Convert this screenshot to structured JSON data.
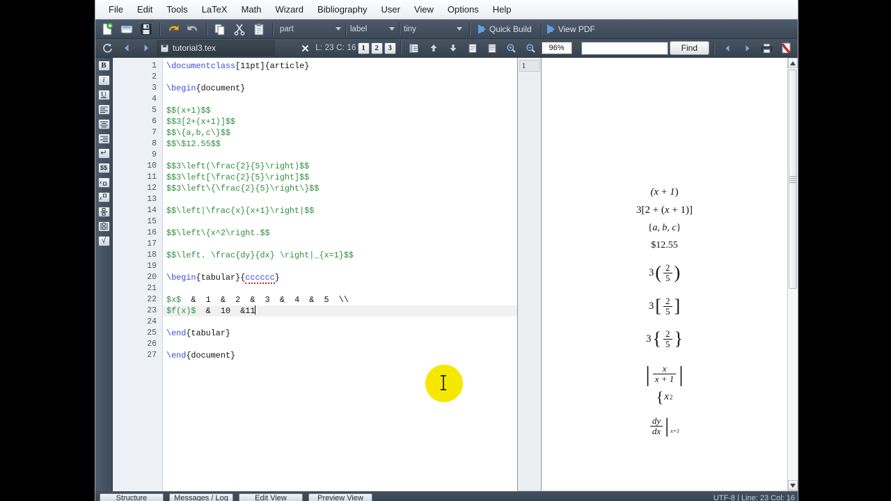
{
  "app": {
    "title": "TeXstudio"
  },
  "menubar": {
    "items": [
      {
        "label": "File",
        "name": "menu-file"
      },
      {
        "label": "Edit",
        "name": "menu-edit"
      },
      {
        "label": "Tools",
        "name": "menu-tools"
      },
      {
        "label": "LaTeX",
        "name": "menu-latex"
      },
      {
        "label": "Math",
        "name": "menu-math"
      },
      {
        "label": "Wizard",
        "name": "menu-wizard"
      },
      {
        "label": "Bibliography",
        "name": "menu-bibliography"
      },
      {
        "label": "User",
        "name": "menu-user"
      },
      {
        "label": "View",
        "name": "menu-view"
      },
      {
        "label": "Options",
        "name": "menu-options"
      },
      {
        "label": "Help",
        "name": "menu-help"
      }
    ]
  },
  "toolbar_main": {
    "icons": [
      {
        "name": "new-document-icon",
        "glyph": "new"
      },
      {
        "name": "open-document-icon",
        "glyph": "open"
      },
      {
        "name": "save-document-icon",
        "glyph": "save"
      },
      {
        "name": "undo-icon",
        "glyph": "undo"
      },
      {
        "name": "redo-icon",
        "glyph": "redo"
      },
      {
        "name": "copy-icon",
        "glyph": "copy"
      },
      {
        "name": "cut-icon",
        "glyph": "cut"
      },
      {
        "name": "paste-icon",
        "glyph": "paste"
      }
    ],
    "combo_structure": "part",
    "combo_label": "label",
    "combo_size": "tiny",
    "quick_build_label": "Quick Build",
    "view_pdf_label": "View PDF"
  },
  "toolbar_doc": {
    "filename": "tutorial3.tex",
    "cursor_position": "L: 23 C: 16",
    "bookmarks": [
      "1",
      "2",
      "3"
    ],
    "zoom": "96%",
    "find_placeholder": "",
    "find_value": "",
    "find_button": "Find"
  },
  "side_tools": {
    "items": [
      {
        "name": "bold-icon",
        "glyph": "B"
      },
      {
        "name": "italic-icon",
        "glyph": "i"
      },
      {
        "name": "underline-icon",
        "glyph": "U"
      },
      {
        "name": "align-left-icon",
        "glyph": "≡"
      },
      {
        "name": "align-center-icon",
        "glyph": "≡"
      },
      {
        "name": "align-right-icon",
        "glyph": "≡"
      },
      {
        "name": "newline-icon",
        "glyph": "↵"
      },
      {
        "name": "math-mode-icon",
        "glyph": "$$"
      },
      {
        "name": "subscript-icon",
        "glyph": "x▫"
      },
      {
        "name": "superscript-icon",
        "glyph": "x▫"
      },
      {
        "name": "fraction-icon",
        "glyph": "▫"
      },
      {
        "name": "binomial-icon",
        "glyph": "▫"
      },
      {
        "name": "sqrt-icon",
        "glyph": "√"
      }
    ]
  },
  "editor": {
    "current_line": 23,
    "lines": [
      {
        "n": 1,
        "tokens": [
          {
            "t": "cmd",
            "s": "\\documentclass"
          },
          {
            "t": "plain",
            "s": "[11pt]{article}"
          }
        ]
      },
      {
        "n": 2,
        "tokens": []
      },
      {
        "n": 3,
        "tokens": [
          {
            "t": "cmd",
            "s": "\\begin"
          },
          {
            "t": "plain",
            "s": "{document}"
          }
        ]
      },
      {
        "n": 4,
        "tokens": []
      },
      {
        "n": 5,
        "tokens": [
          {
            "t": "math",
            "s": "$$(x+1)$$"
          }
        ]
      },
      {
        "n": 6,
        "tokens": [
          {
            "t": "math",
            "s": "$$3[2+(x+1)]$$"
          }
        ]
      },
      {
        "n": 7,
        "tokens": [
          {
            "t": "math",
            "s": "$$\\{a,b,c\\}$$"
          }
        ]
      },
      {
        "n": 8,
        "tokens": [
          {
            "t": "math",
            "s": "$$\\$12.55$$"
          }
        ]
      },
      {
        "n": 9,
        "tokens": []
      },
      {
        "n": 10,
        "tokens": [
          {
            "t": "math",
            "s": "$$3\\left(\\frac{2}{5}\\right)$$"
          }
        ]
      },
      {
        "n": 11,
        "tokens": [
          {
            "t": "math",
            "s": "$$3\\left[\\frac{2}{5}\\right]$$"
          }
        ]
      },
      {
        "n": 12,
        "tokens": [
          {
            "t": "math",
            "s": "$$3\\left\\{\\frac{2}{5}\\right\\}$$"
          }
        ]
      },
      {
        "n": 13,
        "tokens": []
      },
      {
        "n": 14,
        "tokens": [
          {
            "t": "math",
            "s": "$$\\left|\\frac{x}{x+1}\\right|$$"
          }
        ]
      },
      {
        "n": 15,
        "tokens": []
      },
      {
        "n": 16,
        "tokens": [
          {
            "t": "math",
            "s": "$$\\left\\{x^2\\right.$$"
          }
        ]
      },
      {
        "n": 17,
        "tokens": []
      },
      {
        "n": 18,
        "tokens": [
          {
            "t": "math",
            "s": "$$\\left. \\frac{dy}{dx} \\right|_{x=1}$$"
          }
        ]
      },
      {
        "n": 19,
        "tokens": []
      },
      {
        "n": 20,
        "tokens": [
          {
            "t": "cmd",
            "s": "\\begin"
          },
          {
            "t": "plain",
            "s": "{tabular}{"
          },
          {
            "t": "misspell",
            "s": "cccccc"
          },
          {
            "t": "plain",
            "s": "}"
          }
        ]
      },
      {
        "n": 21,
        "tokens": []
      },
      {
        "n": 22,
        "tokens": [
          {
            "t": "math",
            "s": "$x$"
          },
          {
            "t": "plain",
            "s": "  &  1  &  2  &  3  &  4  &  5  \\\\"
          }
        ]
      },
      {
        "n": 23,
        "tokens": [
          {
            "t": "math",
            "s": "$f(x)$"
          },
          {
            "t": "plain",
            "s": "  &  10  &11"
          },
          {
            "t": "caret",
            "s": ""
          }
        ]
      },
      {
        "n": 24,
        "tokens": []
      },
      {
        "n": 25,
        "tokens": [
          {
            "t": "cmd",
            "s": "\\end"
          },
          {
            "t": "plain",
            "s": "{tabular}"
          }
        ]
      },
      {
        "n": 26,
        "tokens": []
      },
      {
        "n": 27,
        "tokens": [
          {
            "t": "cmd",
            "s": "\\end"
          },
          {
            "t": "plain",
            "s": "{document}"
          }
        ]
      }
    ]
  },
  "pdf": {
    "thumbnails": [
      "1"
    ],
    "rendered": [
      {
        "id": "expr-paren",
        "text": "(x + 1)"
      },
      {
        "id": "expr-bracket",
        "text": "3[2 + (x + 1)]"
      },
      {
        "id": "expr-brace",
        "text": "{a, b, c}"
      },
      {
        "id": "expr-dollar",
        "text": "$12.55"
      },
      {
        "id": "expr-frac-paren",
        "text": "3 (2/5)"
      },
      {
        "id": "expr-frac-bracket",
        "text": "3 [2/5]"
      },
      {
        "id": "expr-frac-brace",
        "text": "3 {2/5}"
      },
      {
        "id": "expr-abs-frac",
        "text": "| x/(x+1) |"
      },
      {
        "id": "expr-left-brace-xsq",
        "text": "{ x²"
      },
      {
        "id": "expr-derivative",
        "text": "dy/dx |x=1"
      }
    ],
    "fractions": {
      "two_fifths_num": "2",
      "two_fifths_den": "5",
      "three": "3",
      "x": "x",
      "x_plus_1": "x + 1",
      "dy": "dy",
      "dx": "dx",
      "eval_at": "x=1",
      "x_squared_base": "x",
      "x_squared_exp": "2"
    }
  },
  "statusbar": {
    "buttons": [
      "Structure",
      "Messages / Log",
      "Edit View",
      "Preview View"
    ],
    "right_text": "UTF-8 | Line: 23 Col: 16"
  },
  "colors": {
    "toolbar_dark": "#414e5c",
    "menubar": "#f3f5f7",
    "command_blue": "#3a4bd6",
    "math_green": "#2f8f3f",
    "cursor_highlight": "#f5e800",
    "spellcheck_red": "#d02020"
  }
}
